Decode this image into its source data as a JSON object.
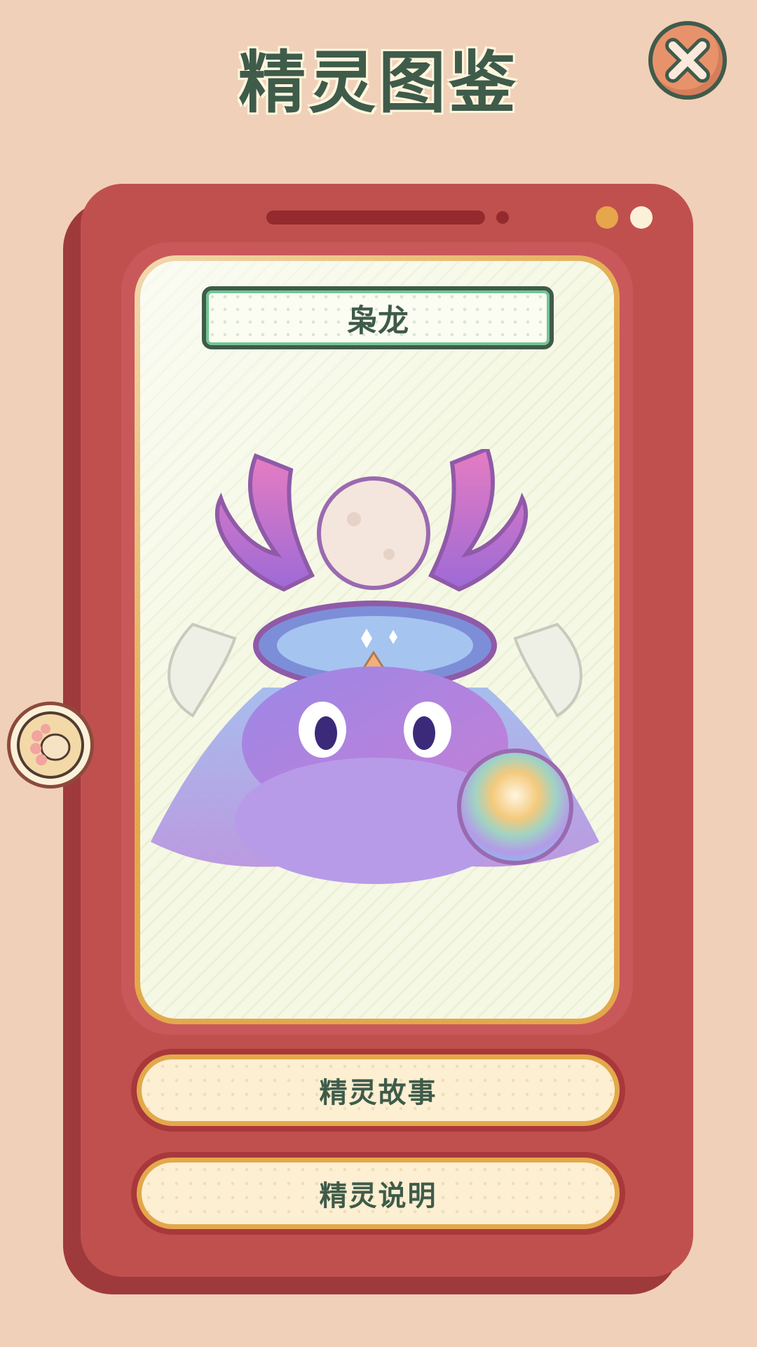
{
  "header": {
    "title": "精灵图鉴",
    "close_icon": "close-icon"
  },
  "card": {
    "creature_name": "枭龙",
    "creature_image": "purple-dragon-creature-with-antlers-and-rainbow-orb",
    "side_button_icon": "paw-icon"
  },
  "buttons": {
    "story_label": "精灵故事",
    "description_label": "精灵说明"
  },
  "colors": {
    "background": "#f0d0b8",
    "device": "#c0504e",
    "accent_gold": "#e3a84b",
    "text_dark_green": "#3f5b4a",
    "name_plate_border": "#74c594"
  }
}
